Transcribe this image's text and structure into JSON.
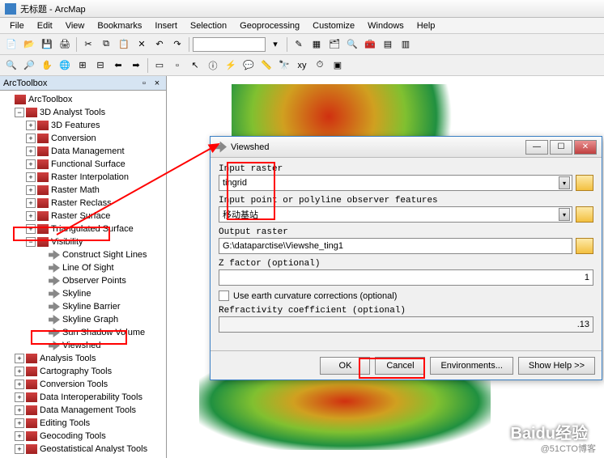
{
  "window_title": "无标题 - ArcMap",
  "menu": [
    "File",
    "Edit",
    "View",
    "Bookmarks",
    "Insert",
    "Selection",
    "Geoprocessing",
    "Customize",
    "Windows",
    "Help"
  ],
  "toc_title": "ArcToolbox",
  "tree": {
    "root": "ArcToolbox",
    "analyst3d": "3D Analyst Tools",
    "items3d": [
      "3D Features",
      "Conversion",
      "Data Management",
      "Functional Surface",
      "Raster Interpolation",
      "Raster Math",
      "Raster Reclass",
      "Raster Surface",
      "Triangulated Surface"
    ],
    "visibility": "Visibility",
    "vis_tools": [
      "Construct Sight Lines",
      "Line Of Sight",
      "Observer Points",
      "Skyline",
      "Skyline Barrier",
      "Skyline Graph",
      "Sun Shadow Volume",
      "Viewshed"
    ],
    "other_toolboxes": [
      "Analysis Tools",
      "Cartography Tools",
      "Conversion Tools",
      "Data Interoperability Tools",
      "Data Management Tools",
      "Editing Tools",
      "Geocoding Tools",
      "Geostatistical Analyst Tools"
    ]
  },
  "dialog": {
    "title": "Viewshed",
    "lbl_input_raster": "Input raster",
    "input_raster": "tingrid",
    "lbl_observer": "Input point or polyline observer features",
    "observer": "移动基站",
    "lbl_output": "Output raster",
    "output": "G:\\dataparctise\\Viewshe_ting1",
    "lbl_zfactor": "Z factor (optional)",
    "zfactor": "1",
    "chk_curvature": "Use earth curvature corrections (optional)",
    "lbl_refractivity": "Refractivity coefficient (optional)",
    "refractivity": ".13",
    "btn_ok": "OK",
    "btn_cancel": "Cancel",
    "btn_env": "Environments...",
    "btn_help": "Show Help >>"
  },
  "watermark_text": "Baidu经验",
  "credit": "@51CTO博客"
}
